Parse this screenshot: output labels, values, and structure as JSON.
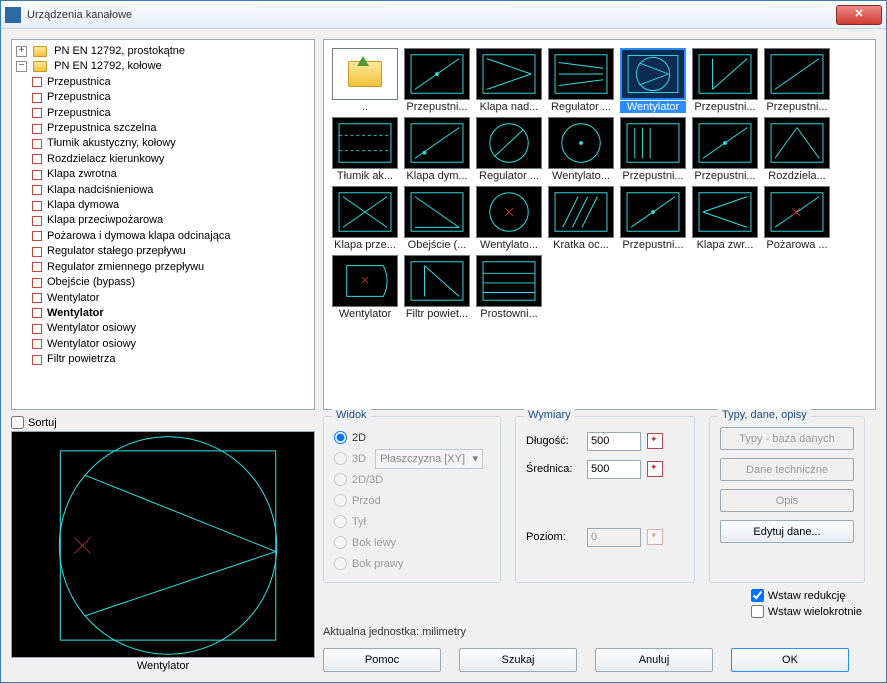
{
  "title": "Urządzenia kanałowe",
  "tree": {
    "root1": "PN EN 12792, prostokątne",
    "root2": "PN EN 12792, kołowe",
    "items": [
      "Przepustnica",
      "Przepustnica",
      "Przepustnica",
      "Przepustnica szczelna",
      "Tłumik akustyczny, kołowy",
      "Rozdzielacz kierunkowy",
      "Klapa zwrotna",
      "Klapa nadciśnieniowa",
      "Klapa dymowa",
      "Klapa przeciwpożarowa",
      "Pożarowa i dymowa klapa odcinająca",
      "Regulator stałego przepływu",
      "Regulator zmiennego przepływu",
      "Obejście (bypass)",
      "Wentylator",
      "Wentylator",
      "Wentylator osiowy",
      "Wentylator osiowy",
      "Filtr powietrza"
    ],
    "bold_index": 15
  },
  "thumbs": [
    {
      "cap": "..",
      "kind": "up"
    },
    {
      "cap": "Przepustni...",
      "kind": "diag-dot"
    },
    {
      "cap": "Klapa nad...",
      "kind": "arrow-r"
    },
    {
      "cap": "Regulator ...",
      "kind": "fan-lines"
    },
    {
      "cap": "Wentylator",
      "kind": "fan-circle",
      "selected": true
    },
    {
      "cap": "Przepustni...",
      "kind": "box-diag"
    },
    {
      "cap": "Przepustni...",
      "kind": "diag"
    },
    {
      "cap": "Tłumik ak...",
      "kind": "dash-box"
    },
    {
      "cap": "Klapa dym...",
      "kind": "diag-dot2"
    },
    {
      "cap": "Regulator ...",
      "kind": "circle-diag"
    },
    {
      "cap": "Wentylato...",
      "kind": "circle-dot"
    },
    {
      "cap": "Przepustni...",
      "kind": "hatch"
    },
    {
      "cap": "Przepustni...",
      "kind": "diag-dot"
    },
    {
      "cap": "Rozdziela...",
      "kind": "tri"
    },
    {
      "cap": "Klapa prze...",
      "kind": "diag2"
    },
    {
      "cap": "Obejście (...",
      "kind": "tri2"
    },
    {
      "cap": "Wentylato...",
      "kind": "circle-x"
    },
    {
      "cap": "Kratka oc...",
      "kind": "hatch2"
    },
    {
      "cap": "Przepustni...",
      "kind": "diag-dot"
    },
    {
      "cap": "Klapa zwr...",
      "kind": "arrow-l"
    },
    {
      "cap": "Pożarowa ...",
      "kind": "diag-x"
    },
    {
      "cap": "Wentylator",
      "kind": "fan-shape"
    },
    {
      "cap": "Filtr powiet...",
      "kind": "filter"
    },
    {
      "cap": "Prostowni...",
      "kind": "bars"
    }
  ],
  "sort_label": "Sortuj",
  "preview_label": "Wentylator",
  "widok": {
    "title": "Widok",
    "r2d": "2D",
    "r3d": "3D",
    "r23": "2D/3D",
    "front": "Przód",
    "back": "Tył",
    "left": "Bok lewy",
    "right": "Bok prawy",
    "plane": "Płaszczyzna  [XY]"
  },
  "wym": {
    "title": "Wymiary",
    "dlugosc": "Długość:",
    "dlugosc_v": "500",
    "srednica": "Średnica:",
    "srednica_v": "500",
    "poziom": "Poziom:",
    "poziom_v": "0"
  },
  "typy": {
    "title": "Typy, dane, opisy",
    "b1": "Typy - baza danych",
    "b2": "Dane techniczne",
    "b3": "Opis",
    "b4": "Edytuj dane..."
  },
  "checks": {
    "red": "Wstaw redukcję",
    "multi": "Wstaw wielokrotnie"
  },
  "unit": "Aktualna jednostka: milimetry",
  "buttons": {
    "pomoc": "Pomoc",
    "szukaj": "Szukaj",
    "anuluj": "Anuluj",
    "ok": "OK"
  }
}
